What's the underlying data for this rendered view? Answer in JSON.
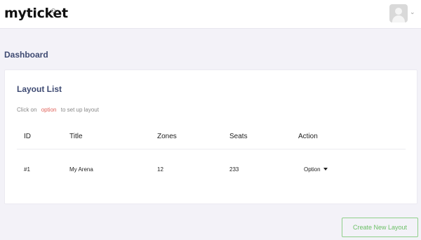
{
  "header": {
    "logo_text": "myticket"
  },
  "page": {
    "title": "Dashboard"
  },
  "card": {
    "title": "Layout List",
    "hint_prefix": "Click on",
    "hint_option": "option",
    "hint_suffix": "to set up layout"
  },
  "table": {
    "columns": [
      "ID",
      "Title",
      "Zones",
      "Seats",
      "Action"
    ],
    "rows": [
      {
        "id": "#1",
        "title": "My Arena",
        "zones": "12",
        "seats": "233",
        "action": "Option"
      }
    ]
  },
  "actions": {
    "create_label": "Create New Layout"
  },
  "colors": {
    "accent": "#3e4a72",
    "hint_highlight": "#e0625a",
    "create_button": "#6bbf66"
  }
}
